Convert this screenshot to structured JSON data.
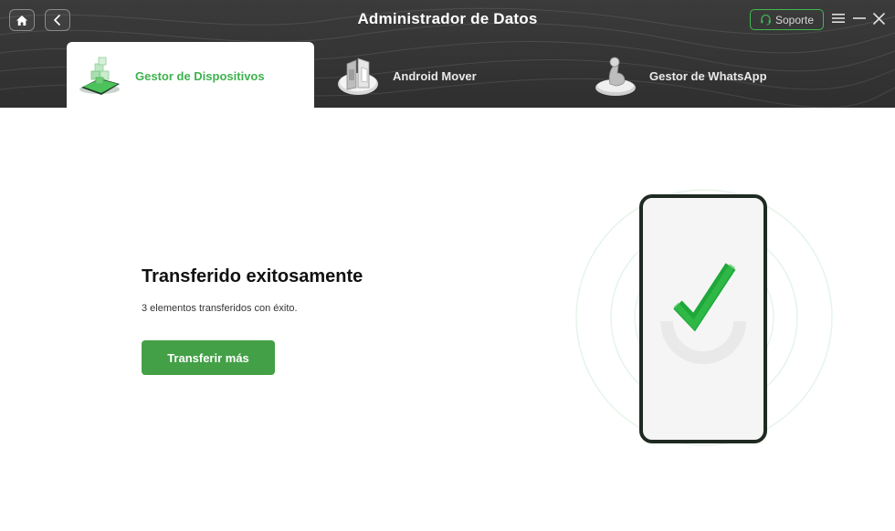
{
  "app": {
    "title": "Administrador de Datos",
    "support_label": "Soporte"
  },
  "header": {
    "home_icon": "home-icon",
    "back_icon": "chevron-left-icon",
    "menu_icon": "hamburger-menu-icon",
    "minimize_icon": "minimize-icon",
    "close_icon": "close-icon",
    "support_icon": "headset-icon"
  },
  "tabs": [
    {
      "label": "Gestor de Dispositivos",
      "icon": "device-manager-icon",
      "active": true
    },
    {
      "label": "Android Mover",
      "icon": "android-mover-icon",
      "active": false
    },
    {
      "label": "Gestor de WhatsApp",
      "icon": "whatsapp-manager-icon",
      "active": false
    }
  ],
  "main": {
    "title": "Transferido exitosamente",
    "description": "3 elementos transferidos con éxito.",
    "button_label": "Transferir más"
  },
  "colors": {
    "accent_green": "#43a047",
    "tab_active_text": "#3eb24f",
    "header_bg": "#333333",
    "phone_frame": "#1e2a22"
  }
}
